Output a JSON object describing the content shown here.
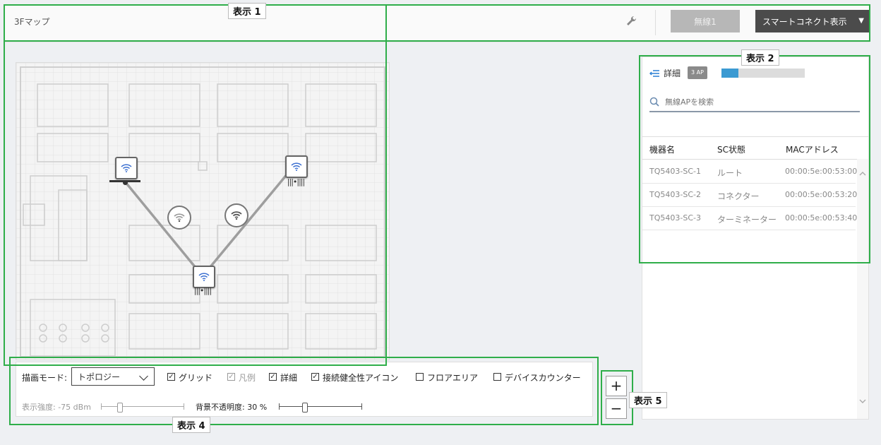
{
  "header": {
    "page_title": "3Fマップ",
    "wireless_button": "無線1",
    "smart_connect_button": "スマートコネクト表示",
    "smart_connect_caret": "▼"
  },
  "panel": {
    "detail_label": "詳細",
    "ap_count_badge": "3 AP",
    "progress_fraction": 0.2,
    "search_placeholder": "無線APを検索",
    "columns": [
      "機器名",
      "SC状態",
      "MACアドレス"
    ],
    "rows": [
      {
        "name": "TQ5403-SC-1",
        "status": "ルート",
        "mac": "00:00:5e:00:53:00"
      },
      {
        "name": "TQ5403-SC-2",
        "status": "コネクター",
        "mac": "00:00:5e:00:53:20"
      },
      {
        "name": "TQ5403-SC-3",
        "status": "ターミネーター",
        "mac": "00:00:5e:00:53:40"
      }
    ]
  },
  "controls": {
    "draw_mode_label": "描画モード:",
    "draw_mode_value": "トポロジー",
    "grid_label": "グリッド",
    "grid_checked": true,
    "legend_label": "凡例",
    "legend_checked": true,
    "legend_disabled": true,
    "detail_label": "詳細",
    "detail_checked": true,
    "health_icon_label": "接続健全性アイコン",
    "health_icon_checked": true,
    "floor_area_label": "フロアエリア",
    "floor_area_checked": false,
    "device_counter_label": "デバイスカウンター",
    "device_counter_checked": false,
    "intensity_label": "表示強度: -75 dBm",
    "opacity_label": "背景不透明度: 30 %",
    "checkmark": "✓"
  },
  "zoom": {
    "in": "+",
    "out": "−"
  },
  "callouts": {
    "label_1": "表示 1",
    "label_2": "表示 2",
    "label_4": "表示 4",
    "label_5": "表示 5"
  },
  "colors": {
    "callout_green": "#2fae4a",
    "progress_blue": "#3b9ad2",
    "dark_button": "#4b4b4b"
  }
}
